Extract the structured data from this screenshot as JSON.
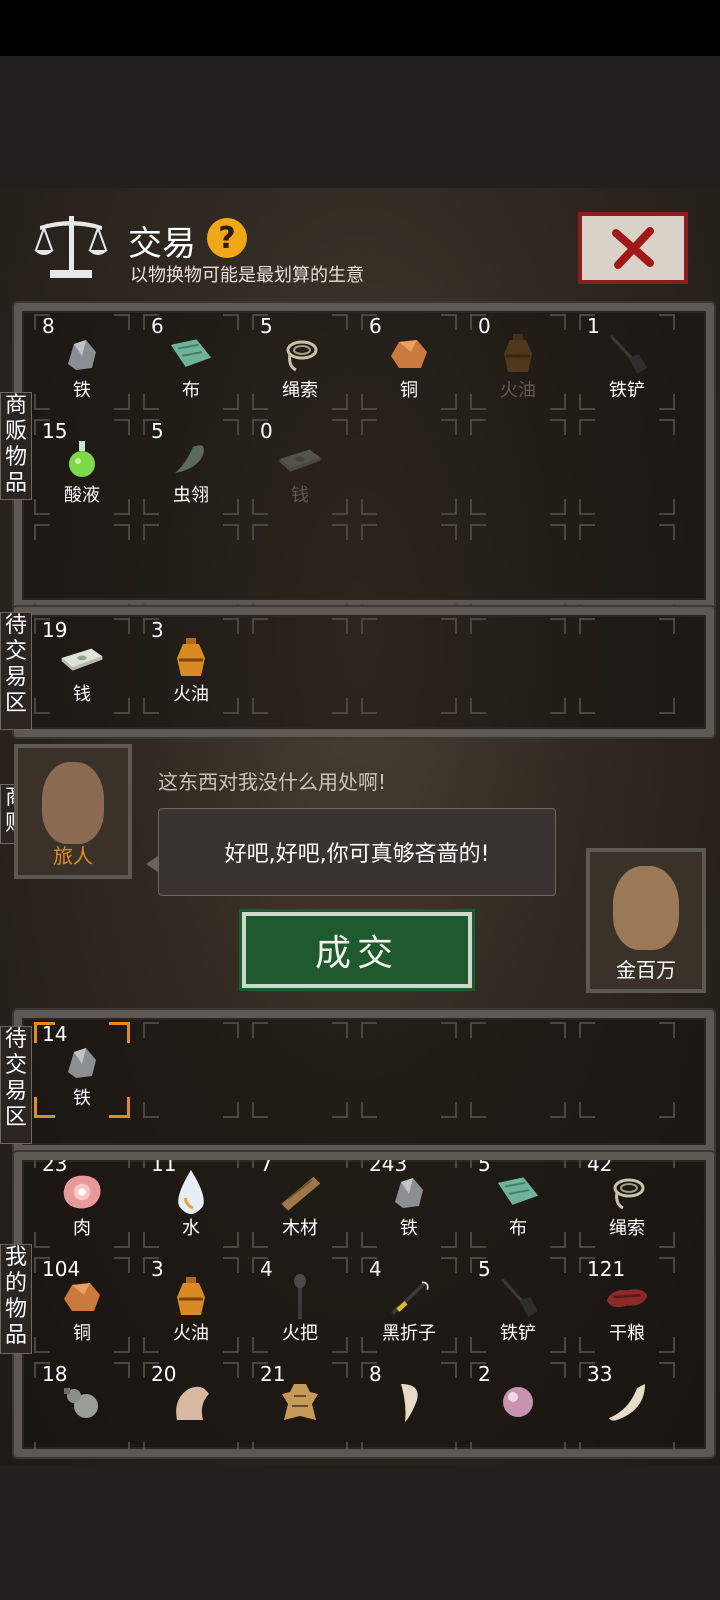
{
  "header": {
    "title": "交易",
    "help": "?",
    "subtitle": "以物换物可能是最划算的生意",
    "close": "close"
  },
  "labels": {
    "merchant_items": "商贩物品",
    "pending_trade_top": "待交易区",
    "merchant": "商贩",
    "pending_trade_bottom": "待交易区",
    "my_items": "我的物品"
  },
  "merchant_items": [
    {
      "count": "8",
      "name": "铁",
      "icon": "iron-ore"
    },
    {
      "count": "6",
      "name": "布",
      "icon": "cloth"
    },
    {
      "count": "5",
      "name": "绳索",
      "icon": "rope"
    },
    {
      "count": "6",
      "name": "铜",
      "icon": "copper-ore"
    },
    {
      "count": "0",
      "name": "火油",
      "icon": "oil-jar"
    },
    {
      "count": "1",
      "name": "铁铲",
      "icon": "shovel"
    },
    {
      "count": "15",
      "name": "酸液",
      "icon": "acid-flask"
    },
    {
      "count": "5",
      "name": "虫翎",
      "icon": "insect-wing"
    },
    {
      "count": "0",
      "name": "钱",
      "icon": "money"
    }
  ],
  "merchant_trade": [
    {
      "count": "19",
      "name": "钱",
      "icon": "money"
    },
    {
      "count": "3",
      "name": "火油",
      "icon": "oil-jar"
    }
  ],
  "dialogue": {
    "traveler_name": "旅人",
    "merchant_line": "这东西对我没什么用处啊!",
    "reply": "好吧,好吧,你可真够吝啬的!",
    "deal_button": "成交",
    "player_name": "金百万"
  },
  "my_trade": [
    {
      "count": "14",
      "name": "铁",
      "icon": "iron-ore",
      "selected": true
    }
  ],
  "my_items": [
    {
      "count": "23",
      "name": "肉",
      "icon": "meat"
    },
    {
      "count": "11",
      "name": "水",
      "icon": "water-drop"
    },
    {
      "count": "7",
      "name": "木材",
      "icon": "wood"
    },
    {
      "count": "243",
      "name": "铁",
      "icon": "iron-ore"
    },
    {
      "count": "5",
      "name": "布",
      "icon": "cloth"
    },
    {
      "count": "42",
      "name": "绳索",
      "icon": "rope"
    },
    {
      "count": "104",
      "name": "铜",
      "icon": "copper-ore"
    },
    {
      "count": "3",
      "name": "火油",
      "icon": "oil-jar"
    },
    {
      "count": "4",
      "name": "火把",
      "icon": "torch"
    },
    {
      "count": "4",
      "name": "黑折子",
      "icon": "fire-starter"
    },
    {
      "count": "5",
      "name": "铁铲",
      "icon": "shovel"
    },
    {
      "count": "121",
      "name": "干粮",
      "icon": "dried-meat"
    },
    {
      "count": "18",
      "name": "",
      "icon": "gourd"
    },
    {
      "count": "20",
      "name": "",
      "icon": "hide"
    },
    {
      "count": "21",
      "name": "",
      "icon": "pelt"
    },
    {
      "count": "8",
      "name": "",
      "icon": "fang"
    },
    {
      "count": "2",
      "name": "",
      "icon": "pearl"
    },
    {
      "count": "33",
      "name": "",
      "icon": "claw"
    }
  ],
  "colors": {
    "accent_orange": "#f0a81a",
    "deal_green": "#1f5a2e",
    "close_red": "#8a1d1d",
    "traveler_name": "#e08a2a"
  }
}
